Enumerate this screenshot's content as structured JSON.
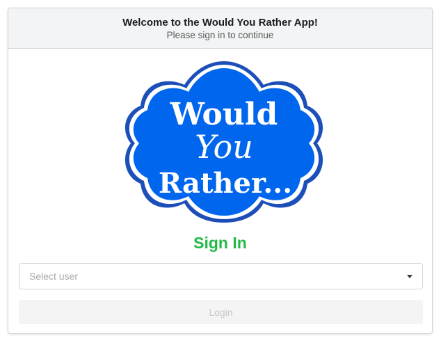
{
  "header": {
    "title": "Welcome to the Would You Rather App!",
    "subtitle": "Please sign in to continue"
  },
  "logo": {
    "line1": "Would",
    "line2": "You",
    "line3": "Rather...",
    "bg_color": "#0066ee",
    "text_color": "#ffffff"
  },
  "signin": {
    "title": "Sign In",
    "title_color": "#21ba45"
  },
  "user_select": {
    "placeholder": "Select user",
    "icon": "dropdown-caret-icon"
  },
  "login_button": {
    "label": "Login",
    "disabled": true
  }
}
